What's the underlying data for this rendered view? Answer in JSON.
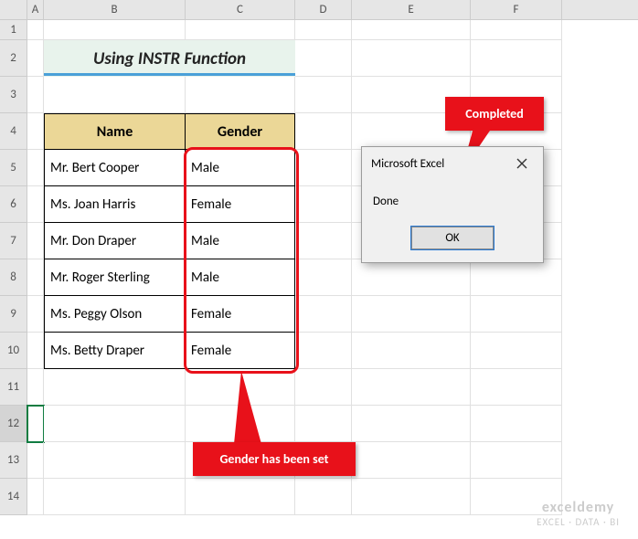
{
  "columns": [
    "A",
    "B",
    "C",
    "D",
    "E",
    "F"
  ],
  "rows": [
    "1",
    "2",
    "3",
    "4",
    "5",
    "6",
    "7",
    "8",
    "9",
    "10",
    "11",
    "12",
    "13",
    "14"
  ],
  "title": "Using INSTR Function",
  "table": {
    "headers": {
      "name": "Name",
      "gender": "Gender"
    },
    "rows": [
      {
        "name": "Mr. Bert Cooper",
        "gender": "Male"
      },
      {
        "name": "Ms. Joan Harris",
        "gender": "Female"
      },
      {
        "name": "Mr. Don Draper",
        "gender": "Male"
      },
      {
        "name": "Mr. Roger Sterling",
        "gender": "Male"
      },
      {
        "name": "Ms. Peggy Olson",
        "gender": "Female"
      },
      {
        "name": "Ms. Betty Draper",
        "gender": "Female"
      }
    ]
  },
  "callouts": {
    "top": "Completed",
    "bottom": "Gender has been set"
  },
  "dialog": {
    "title": "Microsoft Excel",
    "body": "Done",
    "ok": "OK"
  },
  "watermark": {
    "brand": "exceldemy",
    "tagline": "EXCEL · DATA · BI"
  }
}
